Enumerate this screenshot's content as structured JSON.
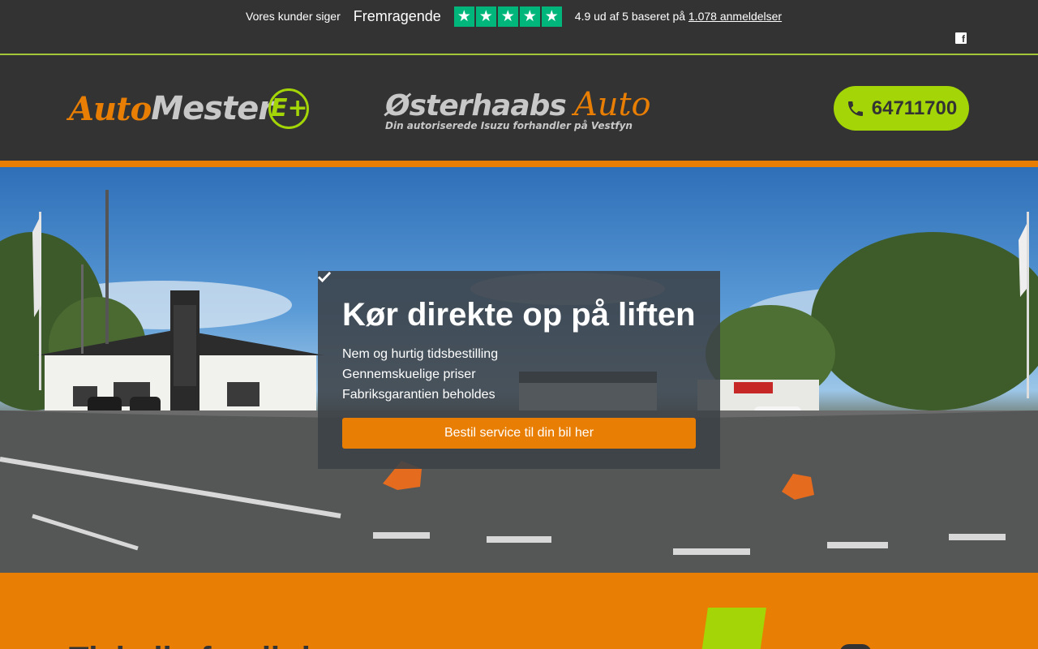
{
  "trustpilot": {
    "says": "Vores kunder siger",
    "rating_word": "Fremragende",
    "stars": 5,
    "summary_prefix": "4.9 ud af 5 baseret på",
    "reviews_link": "1.078 anmeldelser",
    "star_color": "#00b67a"
  },
  "social": {
    "facebook_icon": "facebook-icon"
  },
  "header": {
    "logo_automester": {
      "part1": "Auto",
      "part2": "Mester",
      "part3": "E+"
    },
    "logo_osterhaabs": {
      "name": "Østerhaabs",
      "auto": "Auto",
      "tagline": "Din autoriserede Isuzu forhandler på Vestfyn"
    },
    "phone": "64711700",
    "phone_icon": "phone-icon"
  },
  "hero": {
    "title": "Kør direkte op på liften",
    "bullets": [
      "Nem og hurtig tidsbestilling",
      "Gennemskuelige priser",
      "Fabriksgarantien beholdes"
    ],
    "cta": "Bestil service til din bil her"
  },
  "bottom": {
    "heading": "Tjek din forsikring"
  },
  "colors": {
    "accent_orange": "#e87e04",
    "accent_green": "#a4d507",
    "dark_bg": "#333333"
  }
}
